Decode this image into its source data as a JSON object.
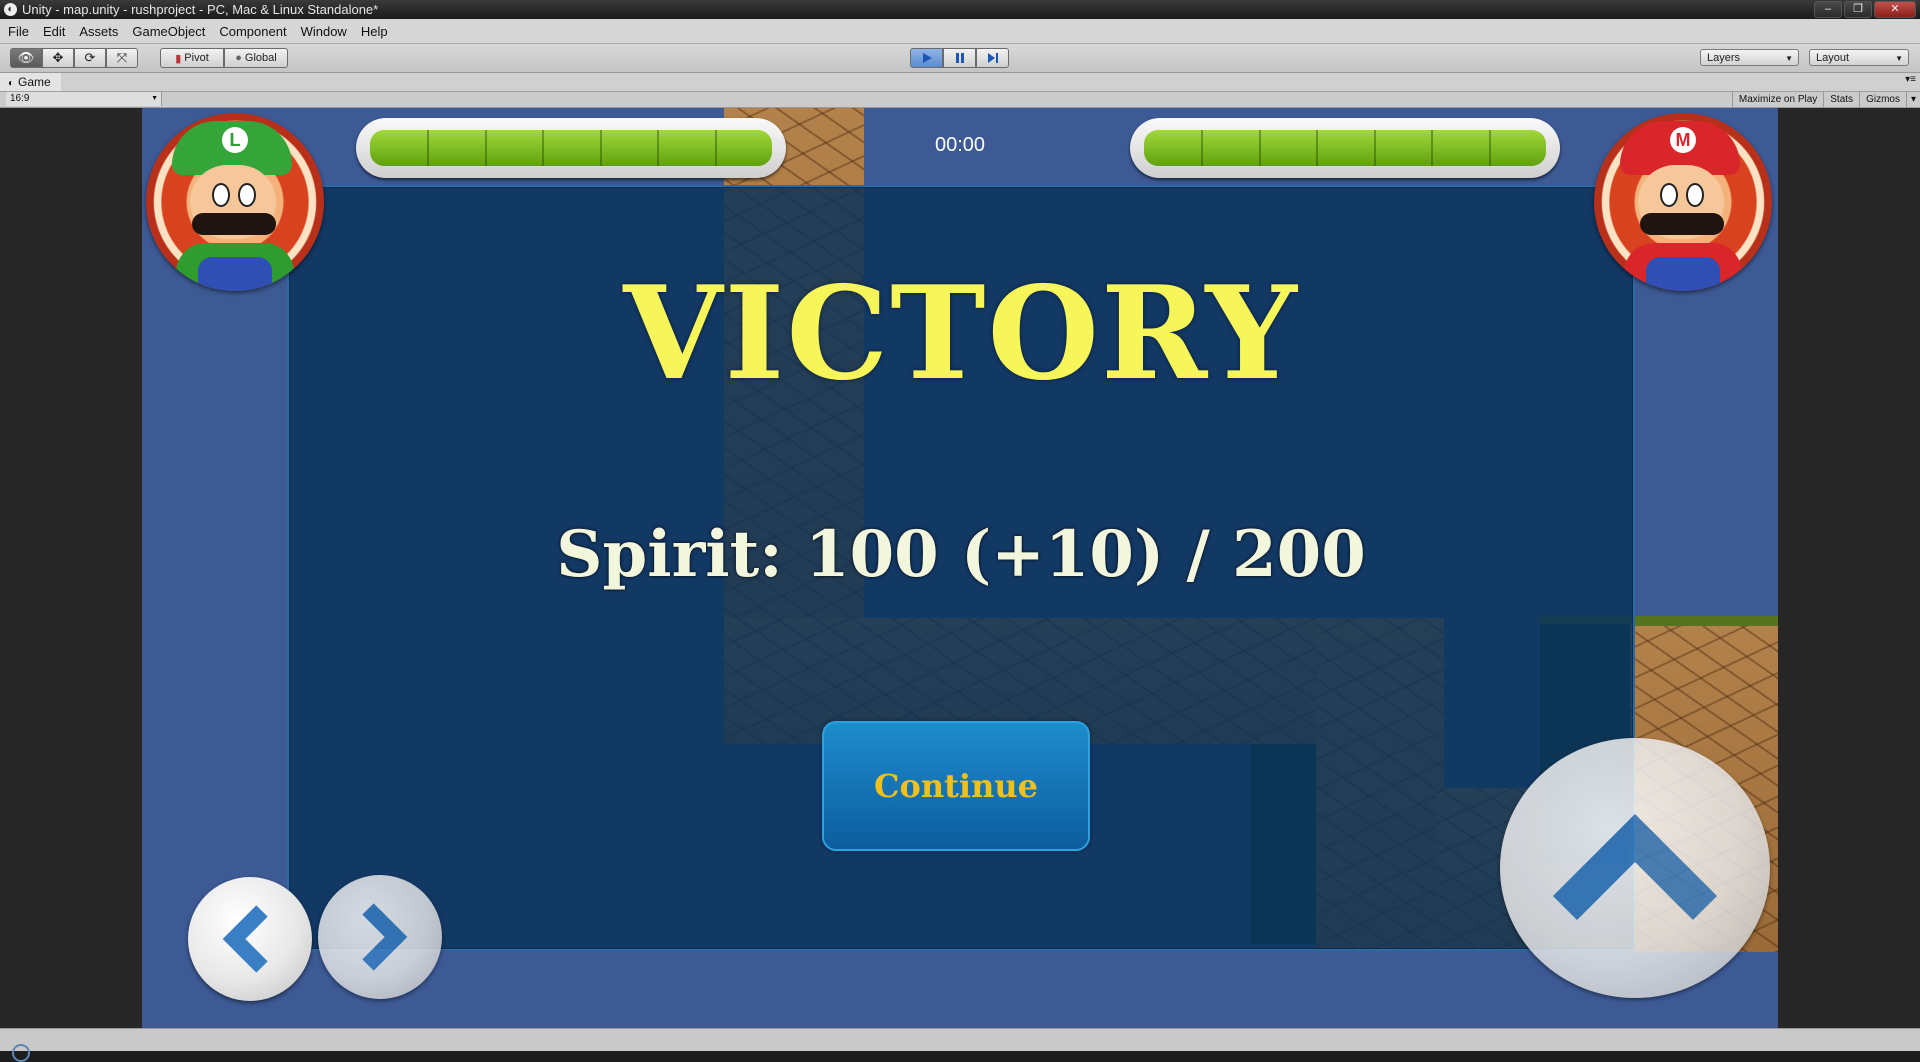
{
  "window": {
    "title": "Unity - map.unity - rushproject - PC, Mac & Linux Standalone*",
    "buttons": [
      "minimize-icon",
      "restore-icon",
      "close-icon"
    ]
  },
  "menu": [
    "File",
    "Edit",
    "Assets",
    "GameObject",
    "Component",
    "Window",
    "Help"
  ],
  "toolbar": {
    "transform_tools": [
      "eye-icon",
      "move-icon",
      "rotate-icon",
      "scale-icon"
    ],
    "pivot_label": "Pivot",
    "global_label": "Global",
    "play_controls": [
      "play-icon",
      "pause-icon",
      "step-icon"
    ],
    "play_active": true,
    "layers_label": "Layers",
    "layout_label": "Layout"
  },
  "game_tab": {
    "label": "Game",
    "aspect": "16:9",
    "toggles": [
      "Maximize on Play",
      "Stats",
      "Gizmos"
    ]
  },
  "hud": {
    "timer": "00:00",
    "left_health": 1.0,
    "right_health": 1.0,
    "left_badge": "L",
    "right_badge": "M"
  },
  "dialog": {
    "title": "VICTORY",
    "spirit": "Spirit: 100 (+10) / 200",
    "continue_label": "Continue"
  },
  "colors": {
    "victory_text": "#f6f65a",
    "continue_text": "#f2c01a",
    "panel_bg": "#0a325a",
    "health_fill": "#7fbf22",
    "scene_bg": "#3d5a95"
  }
}
